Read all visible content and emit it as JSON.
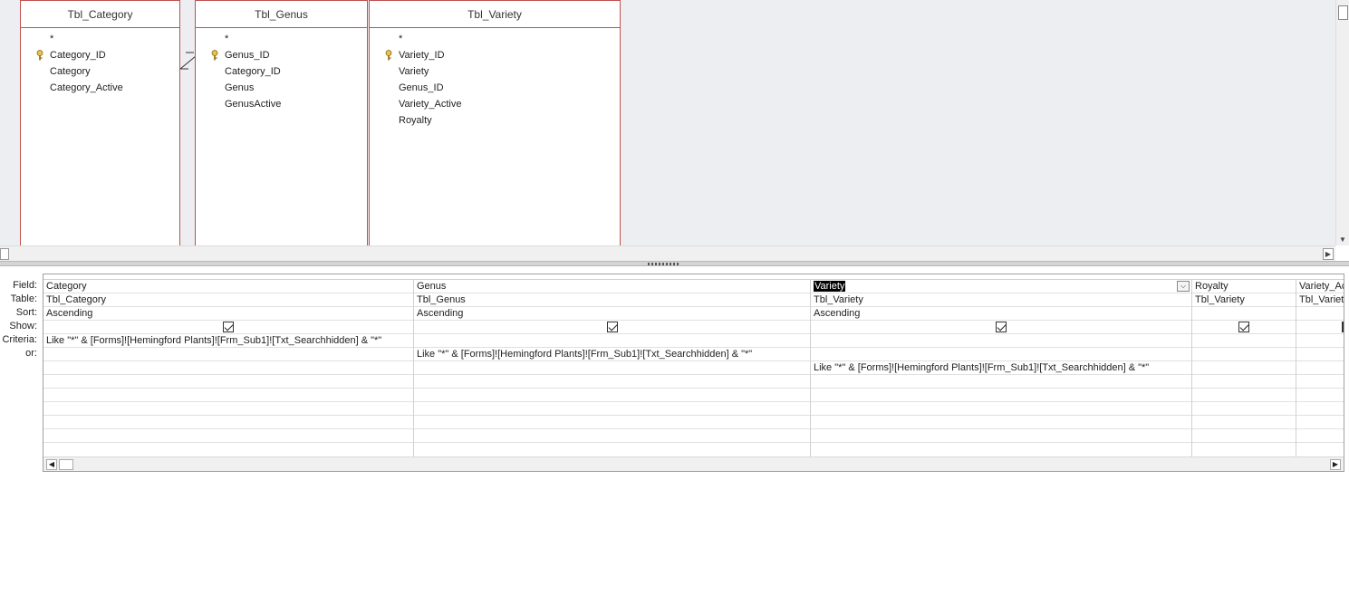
{
  "tables": [
    {
      "name": "Tbl_Category",
      "fields": [
        "*",
        "Category_ID",
        "Category",
        "Category_Active"
      ],
      "key_field": "Category_ID"
    },
    {
      "name": "Tbl_Genus",
      "fields": [
        "*",
        "Genus_ID",
        "Category_ID",
        "Genus",
        "GenusActive"
      ],
      "key_field": "Genus_ID"
    },
    {
      "name": "Tbl_Variety",
      "fields": [
        "*",
        "Variety_ID",
        "Variety",
        "Genus_ID",
        "Variety_Active",
        "Royalty"
      ],
      "key_field": "Variety_ID"
    }
  ],
  "row_labels": [
    "Field:",
    "Table:",
    "Sort:",
    "Show:",
    "Criteria:",
    "or:"
  ],
  "columns": [
    {
      "field": "Category",
      "table": "Tbl_Category",
      "sort": "Ascending",
      "show": true,
      "criteria": "Like \"*\" & [Forms]![Hemingford Plants]![Frm_Sub1]![Txt_Searchhidden] & \"*\"",
      "or1": "",
      "or2": ""
    },
    {
      "field": "Genus",
      "table": "Tbl_Genus",
      "sort": "Ascending",
      "show": true,
      "criteria": "",
      "or1": "Like \"*\" & [Forms]![Hemingford Plants]![Frm_Sub1]![Txt_Searchhidden] & \"*\"",
      "or2": ""
    },
    {
      "field": "Variety",
      "table": "Tbl_Variety",
      "sort": "Ascending",
      "show": true,
      "criteria": "",
      "or1": "",
      "or2": "Like \"*\" & [Forms]![Hemingford Plants]![Frm_Sub1]![Txt_Searchhidden] & \"*\"",
      "selected": true
    },
    {
      "field": "Royalty",
      "table": "Tbl_Variety",
      "sort": "",
      "show": true,
      "criteria": "",
      "or1": "",
      "or2": ""
    },
    {
      "field": "Variety_Ac",
      "table": "Tbl_Variet",
      "sort": "",
      "show": true,
      "criteria": "",
      "or1": "",
      "or2": ""
    }
  ],
  "colors": {
    "table_border": "#c0504d",
    "design_bg": "#eceef1"
  },
  "icons": {
    "key": "key-icon",
    "dropdown": "chevron-down-icon",
    "scroll_left": "arrow-left-icon",
    "scroll_right": "arrow-right-icon"
  }
}
